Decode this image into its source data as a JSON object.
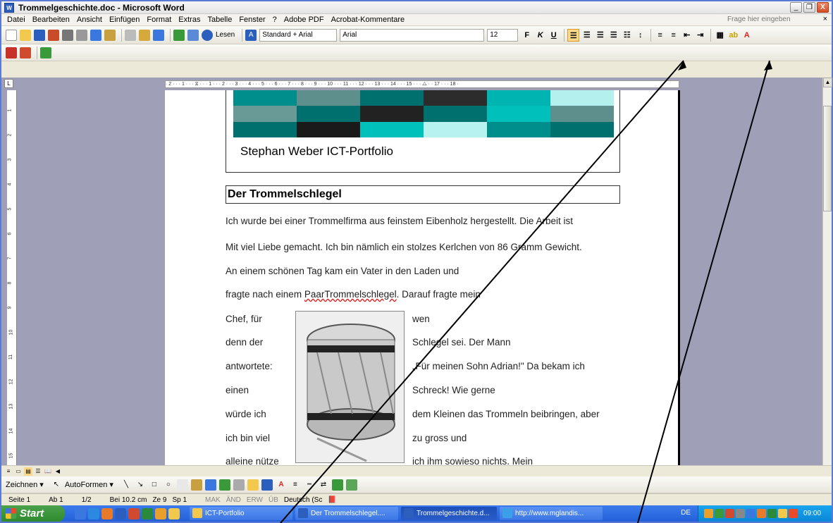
{
  "window": {
    "title": "Trommelgeschichte.doc - Microsoft Word",
    "app_icon": "W",
    "controls": [
      "_",
      "❐",
      "X"
    ]
  },
  "menu": {
    "items": [
      "Datei",
      "Bearbeiten",
      "Ansicht",
      "Einfügen",
      "Format",
      "Extras",
      "Tabelle",
      "Fenster",
      "?",
      "Adobe PDF",
      "Acrobat-Kommentare"
    ],
    "ask_placeholder": "Frage hier eingeben",
    "close": "× "
  },
  "toolbar": {
    "legen_label": "Lesen",
    "style_value": "Standard + Arial",
    "font_value": "Arial",
    "size_value": "12",
    "bold": "F",
    "italic": "K",
    "underline": "U"
  },
  "ruler": {
    "text": "· 2 · · · 1 · · · ⧖ · · · 1 · · · 2 · · · 3 · · · 4 · · · 5 · · · 6 · · · 7 · · · 8 · · · 9 · · · 10 · · · 11 · · · 12 · · · 13 · · · 14 · · · 15 · · · ⧍ · · 17 · · · 18 ·",
    "vertical_marks": [
      "1",
      "2",
      "3",
      "4",
      "5",
      "6",
      "7",
      "8",
      "9",
      "10",
      "11",
      "12",
      "13",
      "14",
      "15"
    ]
  },
  "document": {
    "header_title": "Stephan Weber ICT-Portfolio",
    "heading": "Der Trommelschlegel",
    "lines": [
      "Ich wurde bei einer Trommelfirma aus feinstem Eibenholz hergestellt. Die Arbeit ist",
      "Mit viel Liebe gemacht. Ich bin nämlich ein stolzes Kerlchen von 86 Gramm Gewicht.",
      "An einem schönen Tag kam ein Vater in den Laden und",
      "fragte nach einem "
    ],
    "misspelled": "PaarTrommelschlegel",
    "line4_rest": ". Darauf fragte mein",
    "left_column": [
      "Chef, für",
      "denn der",
      "antwortete:",
      "einen",
      "würde ich",
      "ich bin viel",
      "alleine nütze"
    ],
    "right_column": [
      "wen",
      "Schlegel sei. Der Mann",
      "„Für meinen Sohn Adrian!\" Da bekam ich",
      "Schreck! Wie gerne",
      "dem Kleinen das Trommeln beibringen, aber",
      "zu gross und",
      "ich ihm sowieso nichts. Mein"
    ],
    "banner_colors": [
      "#008e8c",
      "#5f8f8c",
      "#00706e",
      "#2c2c2c",
      "#00b4b2",
      "#b4f0ee",
      "#6a9a96",
      "#00706e",
      "#222222",
      "#00706e",
      "#00c0bc",
      "#5f8f8c",
      "#00706e",
      "#1a1a1a",
      "#00c0bc",
      "#b8f2f0",
      "#008e8c",
      "#00706e"
    ]
  },
  "drawing": {
    "zeichnen": "Zeichnen ▾",
    "autoformen": "AutoFormen ▾"
  },
  "status": {
    "seite": "Seite 1",
    "ab": "Ab 1",
    "pages": "1/2",
    "bei": "Bei 10.2 cm",
    "ze": "Ze 9",
    "sp": "Sp 1",
    "mak": "MAK",
    "aend": "ÄND",
    "erw": "ERW",
    "ueb": "ÜB",
    "lang": "Deutsch (Sc"
  },
  "taskbar": {
    "start": "Start",
    "tasks": [
      {
        "label": "ICT-Portfolio",
        "color": "#f2c94c",
        "active": false
      },
      {
        "label": "Der Trommelschlegel....",
        "color": "#2b5ebd",
        "active": false
      },
      {
        "label": "Trommelgeschichte.d...",
        "color": "#2b5ebd",
        "active": true
      },
      {
        "label": "http://www.mglandis...",
        "color": "#3aa0e8",
        "active": false
      }
    ],
    "lang": "DE",
    "clock": "09:00"
  }
}
